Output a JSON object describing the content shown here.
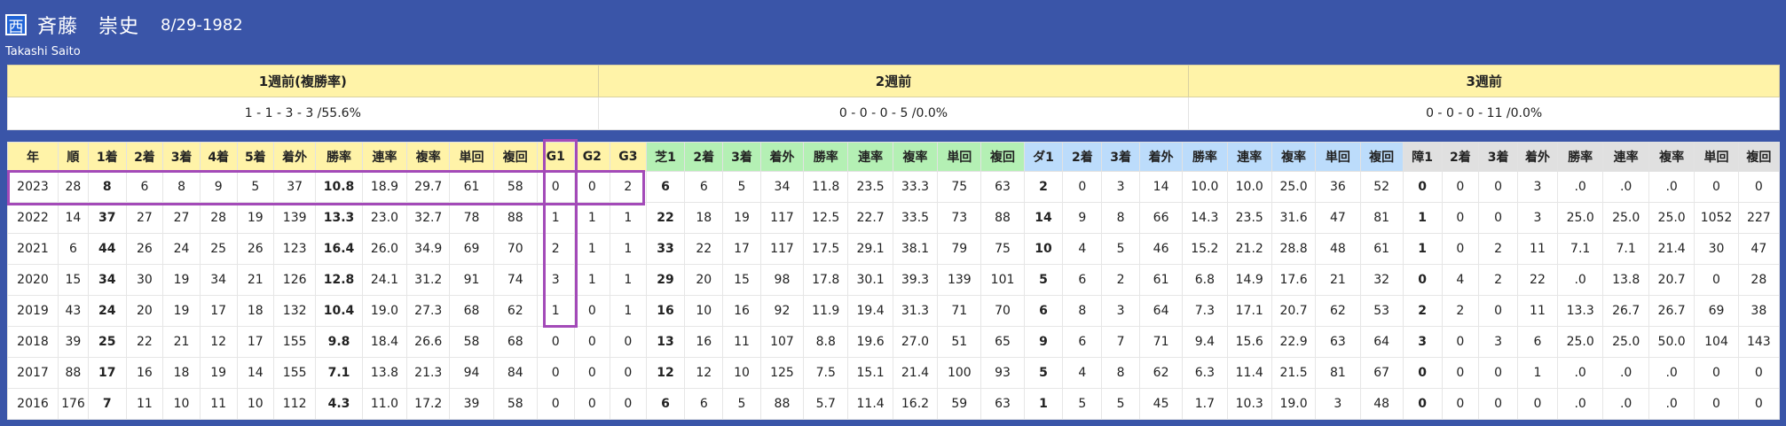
{
  "header": {
    "badge": "西",
    "name": "斉藤　崇史",
    "birth": "8/29-1982",
    "name_en": "Takashi Saito"
  },
  "recent": {
    "headers": [
      "1週前(複勝率)",
      "2週前",
      "3週前"
    ],
    "values": [
      "1 - 1 - 3 - 3 /55.6%",
      "0 - 0 - 0 - 5 /0.0%",
      "0 - 0 - 0 - 11 /0.0%"
    ]
  },
  "stats": {
    "headers": [
      "年",
      "順",
      "1着",
      "2着",
      "3着",
      "4着",
      "5着",
      "着外",
      "勝率",
      "連率",
      "複率",
      "単回",
      "複回",
      "G1",
      "G2",
      "G3",
      "芝1",
      "2着",
      "3着",
      "着外",
      "勝率",
      "連率",
      "複率",
      "単回",
      "複回",
      "ダ1",
      "2着",
      "3着",
      "着外",
      "勝率",
      "連率",
      "複率",
      "単回",
      "複回",
      "障1",
      "2着",
      "3着",
      "着外",
      "勝率",
      "連率",
      "複率",
      "単回",
      "複回"
    ],
    "header_colors": [
      "y",
      "y",
      "y",
      "y",
      "y",
      "y",
      "y",
      "y",
      "y",
      "y",
      "y",
      "y",
      "y",
      "y",
      "y",
      "y",
      "g",
      "g",
      "g",
      "g",
      "g",
      "g",
      "g",
      "g",
      "g",
      "b",
      "b",
      "b",
      "b",
      "b",
      "b",
      "b",
      "b",
      "b",
      "gr",
      "gr",
      "gr",
      "gr",
      "gr",
      "gr",
      "gr",
      "gr",
      "gr"
    ],
    "bold_columns": [
      2,
      8,
      16,
      25,
      34
    ],
    "rows": [
      [
        "2023",
        "28",
        "8",
        "6",
        "8",
        "9",
        "5",
        "37",
        "10.8",
        "18.9",
        "29.7",
        "61",
        "58",
        "0",
        "0",
        "2",
        "6",
        "6",
        "5",
        "34",
        "11.8",
        "23.5",
        "33.3",
        "75",
        "63",
        "2",
        "0",
        "3",
        "14",
        "10.0",
        "10.0",
        "25.0",
        "36",
        "52",
        "0",
        "0",
        "0",
        "3",
        ".0",
        ".0",
        ".0",
        "0",
        "0"
      ],
      [
        "2022",
        "14",
        "37",
        "27",
        "27",
        "28",
        "19",
        "139",
        "13.3",
        "23.0",
        "32.7",
        "78",
        "88",
        "1",
        "1",
        "1",
        "22",
        "18",
        "19",
        "117",
        "12.5",
        "22.7",
        "33.5",
        "73",
        "88",
        "14",
        "9",
        "8",
        "66",
        "14.3",
        "23.5",
        "31.6",
        "47",
        "81",
        "1",
        "0",
        "0",
        "3",
        "25.0",
        "25.0",
        "25.0",
        "1052",
        "227"
      ],
      [
        "2021",
        "6",
        "44",
        "26",
        "24",
        "25",
        "26",
        "123",
        "16.4",
        "26.0",
        "34.9",
        "69",
        "70",
        "2",
        "1",
        "1",
        "33",
        "22",
        "17",
        "117",
        "17.5",
        "29.1",
        "38.1",
        "79",
        "75",
        "10",
        "4",
        "5",
        "46",
        "15.2",
        "21.2",
        "28.8",
        "48",
        "61",
        "1",
        "0",
        "2",
        "11",
        "7.1",
        "7.1",
        "21.4",
        "30",
        "47"
      ],
      [
        "2020",
        "15",
        "34",
        "30",
        "19",
        "34",
        "21",
        "126",
        "12.8",
        "24.1",
        "31.2",
        "91",
        "74",
        "3",
        "1",
        "1",
        "29",
        "20",
        "15",
        "98",
        "17.8",
        "30.1",
        "39.3",
        "139",
        "101",
        "5",
        "6",
        "2",
        "61",
        "6.8",
        "14.9",
        "17.6",
        "21",
        "32",
        "0",
        "4",
        "2",
        "22",
        ".0",
        "13.8",
        "20.7",
        "0",
        "28"
      ],
      [
        "2019",
        "43",
        "24",
        "20",
        "19",
        "17",
        "18",
        "132",
        "10.4",
        "19.0",
        "27.3",
        "68",
        "62",
        "1",
        "0",
        "1",
        "16",
        "10",
        "16",
        "92",
        "11.9",
        "19.4",
        "31.3",
        "71",
        "70",
        "6",
        "8",
        "3",
        "64",
        "7.3",
        "17.1",
        "20.7",
        "62",
        "53",
        "2",
        "2",
        "0",
        "11",
        "13.3",
        "26.7",
        "26.7",
        "69",
        "38"
      ],
      [
        "2018",
        "39",
        "25",
        "22",
        "21",
        "12",
        "17",
        "155",
        "9.8",
        "18.4",
        "26.6",
        "58",
        "68",
        "0",
        "0",
        "0",
        "13",
        "16",
        "11",
        "107",
        "8.8",
        "19.6",
        "27.0",
        "51",
        "65",
        "9",
        "6",
        "7",
        "71",
        "9.4",
        "15.6",
        "22.9",
        "63",
        "64",
        "3",
        "0",
        "3",
        "6",
        "25.0",
        "25.0",
        "50.0",
        "104",
        "143"
      ],
      [
        "2017",
        "88",
        "17",
        "16",
        "18",
        "19",
        "14",
        "155",
        "7.1",
        "13.8",
        "21.3",
        "94",
        "84",
        "0",
        "0",
        "0",
        "12",
        "12",
        "10",
        "125",
        "7.5",
        "15.1",
        "21.4",
        "100",
        "93",
        "5",
        "4",
        "8",
        "62",
        "6.3",
        "11.4",
        "21.5",
        "81",
        "67",
        "0",
        "0",
        "0",
        "1",
        ".0",
        ".0",
        ".0",
        "0",
        "0"
      ],
      [
        "2016",
        "176",
        "7",
        "11",
        "10",
        "11",
        "10",
        "112",
        "4.3",
        "11.0",
        "17.2",
        "39",
        "58",
        "0",
        "0",
        "0",
        "6",
        "6",
        "5",
        "88",
        "5.7",
        "11.4",
        "16.2",
        "59",
        "63",
        "1",
        "5",
        "5",
        "45",
        "1.7",
        "10.3",
        "19.0",
        "3",
        "48",
        "0",
        "0",
        "0",
        "0",
        ".0",
        ".0",
        ".0",
        "0",
        "0"
      ]
    ]
  }
}
